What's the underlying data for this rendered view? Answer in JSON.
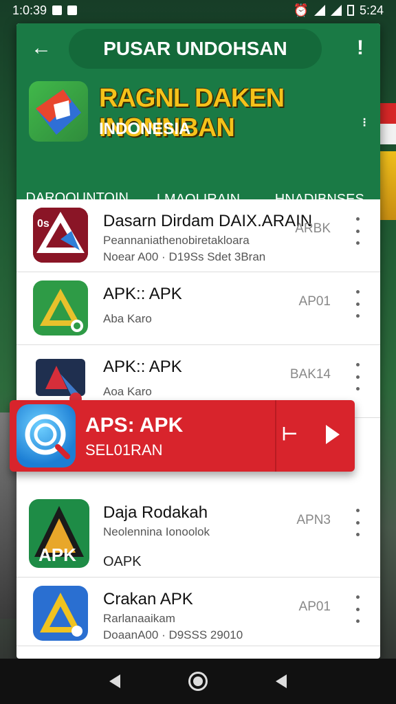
{
  "status_bar": {
    "time": "1:0:39",
    "right_time": "5:24"
  },
  "app_bar": {
    "title": "PUSAR UNDOHSAN",
    "back_icon": "back-arrow-icon",
    "menu_icon": "more-vert-icon"
  },
  "hero": {
    "title": "RAGNL DAKEN INONNBAN",
    "subtitle": "INDONESIA"
  },
  "tabs": [
    {
      "label": "DAROOUNTOIN",
      "active": true
    },
    {
      "label": "LMAOLIRAIN",
      "active": false
    },
    {
      "label": "HNADIBNSES",
      "active": false
    }
  ],
  "apps": [
    {
      "name": "Dasarn Dirdam DAIX.ARAIN",
      "line2": "Peannaniathenobiretakloara",
      "line3": "Noear A00 · D19Ss Sdet 3Bran",
      "code": "ARBK",
      "icon": "app-icon-red-arrow"
    },
    {
      "name": "APK:: APK",
      "line2": "Aba Karo",
      "line3": "",
      "code": "AP01",
      "icon": "app-icon-green-triangle"
    },
    {
      "name": "APK:: APK",
      "line2": "Aoa Karo",
      "line3": "",
      "code": "BAK14",
      "icon": "app-icon-dark-arrow"
    }
  ],
  "featured": {
    "name": "APS: APK",
    "subtitle": "SEL01RAN",
    "icon": "search-chat-icon"
  },
  "apps_after": [
    {
      "name": "Daja Rodakah",
      "line2": "Neolennina Ionoolok",
      "line3": "OAPK",
      "code": "APN3",
      "icon": "apk-logo-icon"
    },
    {
      "name": "Crakan APK",
      "line2": "Rarlanaaikam",
      "line3": "DoaanA00 · D9SSS 29010",
      "code": "AP01",
      "icon": "app-icon-blue-triangle"
    }
  ]
}
